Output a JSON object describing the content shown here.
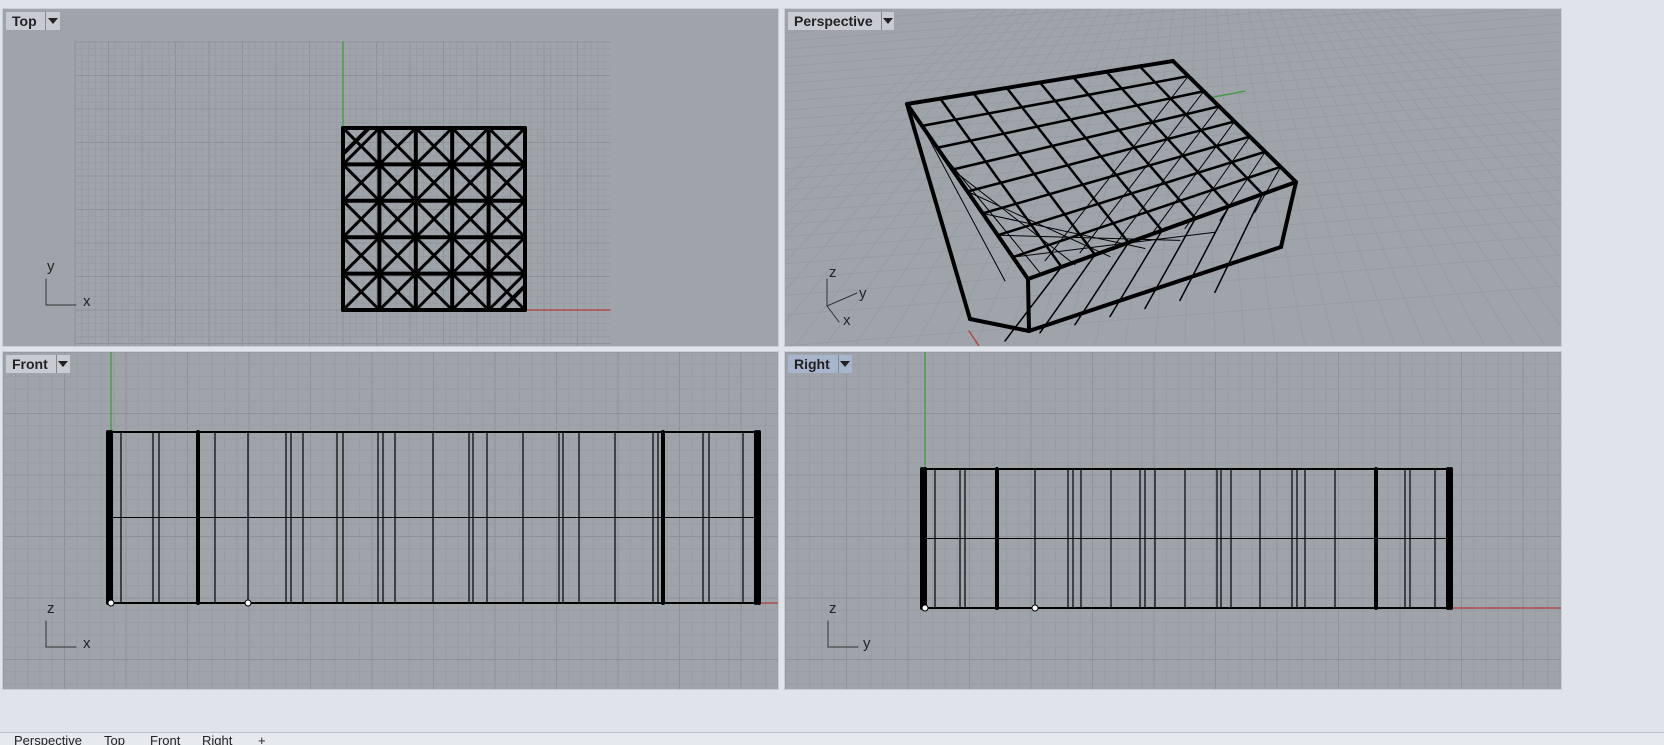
{
  "viewports": {
    "top": {
      "label": "Top",
      "axes": {
        "a": "y",
        "b": "x"
      }
    },
    "perspective": {
      "label": "Perspective",
      "axes": {
        "a": "z",
        "b": "y",
        "c": "x"
      }
    },
    "front": {
      "label": "Front",
      "axes": {
        "a": "z",
        "b": "x"
      }
    },
    "right": {
      "label": "Right",
      "axes": {
        "a": "z",
        "b": "y"
      }
    }
  },
  "bottom_tabs": [
    "Perspective",
    "Top",
    "Front",
    "Right",
    "+"
  ],
  "colors": {
    "viewport_bg": "#9fa4ab",
    "grid_minor": "#979ca3",
    "grid_major": "#8d9299",
    "axis_x": "#b23a3a",
    "axis_y": "#3a9a3a",
    "geometry": "#000000",
    "active_tab": "#a7b6cc"
  }
}
